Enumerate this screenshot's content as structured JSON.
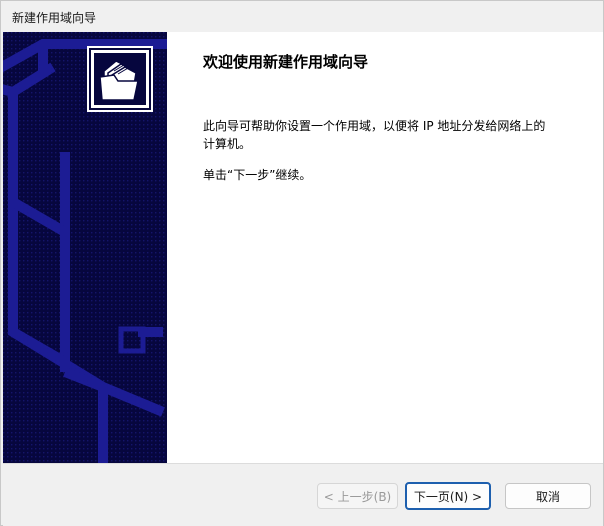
{
  "window": {
    "title": "新建作用域向导"
  },
  "main": {
    "heading": "欢迎使用新建作用域向导",
    "description": "此向导可帮助你设置一个作用域，以便将 IP 地址分发给网络上的计算机。",
    "hint": "单击“下一步”继续。"
  },
  "buttons": {
    "back_label": "< 上一步(B)",
    "next_label": "下一页(N) >",
    "cancel_label": "取消"
  },
  "icons": {
    "banner_logo": "folders-icon"
  },
  "colors": {
    "side_panel": "#06063e",
    "panel_lines": "#1a1a8a",
    "default_button_border": "#1d5fae"
  }
}
